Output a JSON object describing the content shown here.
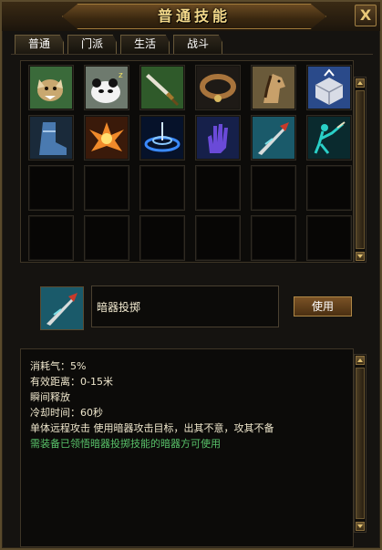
{
  "window": {
    "title": "普通技能",
    "close_label": "X"
  },
  "tabs": [
    {
      "label": "普通",
      "active": true
    },
    {
      "label": "门派",
      "active": false
    },
    {
      "label": "生活",
      "active": false
    },
    {
      "label": "战斗",
      "active": false
    }
  ],
  "skill_grid": {
    "slots": [
      {
        "icon": "wolf-icon"
      },
      {
        "icon": "panda-sleep-icon"
      },
      {
        "icon": "sword-icon"
      },
      {
        "icon": "collar-icon"
      },
      {
        "icon": "horse-icon"
      },
      {
        "icon": "chest-box-icon"
      },
      {
        "icon": "boot-icon"
      },
      {
        "icon": "flame-burst-icon"
      },
      {
        "icon": "blue-vortex-icon"
      },
      {
        "icon": "purple-hand-icon"
      },
      {
        "icon": "dart-throw-icon"
      },
      {
        "icon": "shadow-figure-icon"
      },
      {
        "icon": "empty"
      },
      {
        "icon": "empty"
      },
      {
        "icon": "empty"
      },
      {
        "icon": "empty"
      },
      {
        "icon": "empty"
      },
      {
        "icon": "empty"
      },
      {
        "icon": "empty"
      },
      {
        "icon": "empty"
      },
      {
        "icon": "empty"
      },
      {
        "icon": "empty"
      },
      {
        "icon": "empty"
      },
      {
        "icon": "empty"
      }
    ]
  },
  "selected_skill": {
    "name": "暗器投掷",
    "icon": "dart-throw-icon",
    "use_label": "使用"
  },
  "description": {
    "lines": [
      {
        "text": "消耗气：5%",
        "color": "#eee6cc"
      },
      {
        "text": "有效距离：0-15米",
        "color": "#eee6cc"
      },
      {
        "text": "瞬间释放",
        "color": "#eee6cc"
      },
      {
        "text": "冷却时间：60秒",
        "color": "#eee6cc"
      },
      {
        "text": "单体远程攻击 使用暗器攻击目标，出其不意，攻其不备",
        "color": "#eee6cc"
      },
      {
        "text": "需装备已领悟暗器投掷技能的暗器方可使用",
        "color": "#59c36a"
      }
    ]
  },
  "colors": {
    "title_gold": "#f3d98a",
    "frame_brown": "#5a4a2c",
    "hint_green": "#59c36a"
  }
}
